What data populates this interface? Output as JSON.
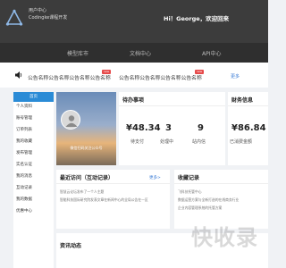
{
  "header": {
    "brand_line1": "用户中心",
    "brand_line2": "Codingke课程开发",
    "greeting": "Hi！George，欢迎回来"
  },
  "nav": {
    "items": [
      "模型库市",
      "文档中心",
      "API中心"
    ]
  },
  "notice": {
    "items": [
      "公告名称公告名称公告名称公告名称",
      "公告名称公告名称公告名称公告名称"
    ],
    "badge": "new",
    "more": "更多"
  },
  "sidebar": {
    "items": [
      "首页",
      "个人资料",
      "账号管理",
      "订单列表",
      "我的收藏",
      "发布管理",
      "实名认证",
      "我的消息",
      "互动记录",
      "我的数据",
      "优惠中心"
    ]
  },
  "avatar_card": {
    "caption": "微信扫码关注公众号"
  },
  "pending": {
    "title": "待办事项",
    "stats": [
      {
        "value": "¥48.34",
        "label": "待支付"
      },
      {
        "value": "3",
        "label": "处理中"
      },
      {
        "value": "9",
        "label": "站内信"
      }
    ]
  },
  "finance": {
    "title": "财务信息",
    "value": "¥86.84",
    "label": "已消费金额"
  },
  "recent": {
    "title": "最近访问（互动记录）",
    "more": "更多>",
    "lines": [
      "智慧云论坛发布了一个人主题",
      "智能科技国际研究院发表文章在新闻中心的全局公告在一区"
    ]
  },
  "favorites": {
    "title": "收藏记录",
    "lines": [
      "飞科技托管中心",
      "数据运营方案与全新打造的在线商务行业",
      "企业内容管理系统的托管方案"
    ]
  },
  "dynamics": {
    "title": "资讯动态"
  },
  "watermark": "快收录"
}
